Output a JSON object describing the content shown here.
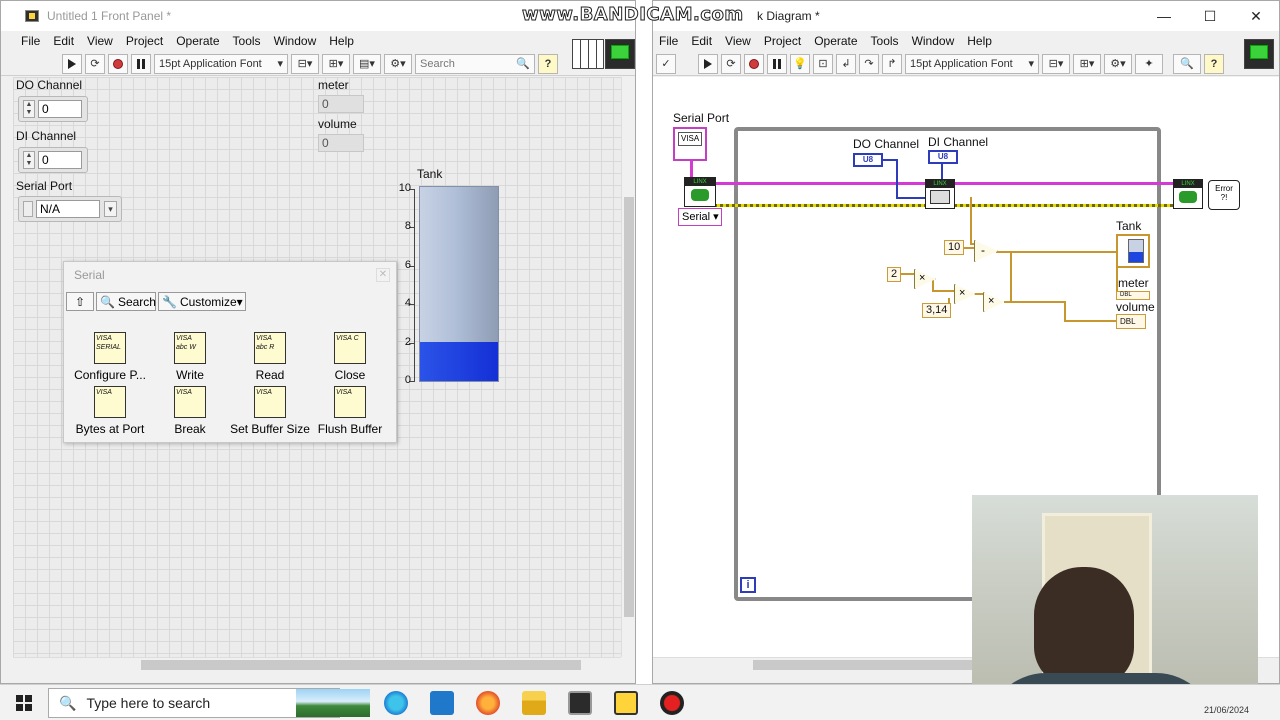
{
  "watermark": "www.BANDICAM.com",
  "front_panel": {
    "title": "Untitled 1 Front Panel *",
    "menu": [
      "File",
      "Edit",
      "View",
      "Project",
      "Operate",
      "Tools",
      "Window",
      "Help"
    ],
    "font_select": "15pt Application Font",
    "search_placeholder": "Search",
    "controls": {
      "do_channel": {
        "label": "DO Channel",
        "value": "0"
      },
      "di_channel": {
        "label": "DI Channel",
        "value": "0"
      },
      "serial_port": {
        "label": "Serial Port",
        "value": "N/A"
      },
      "meter": {
        "label": "meter",
        "value": "0"
      },
      "volume": {
        "label": "volume",
        "value": "0"
      }
    },
    "tank": {
      "label": "Tank",
      "scale": [
        "10",
        "8",
        "6",
        "4",
        "2",
        "0"
      ],
      "scale_max": 10,
      "level": 2
    },
    "palette": {
      "title": "Serial",
      "search": "Search",
      "customize": "Customize▾",
      "items": [
        {
          "label": "Configure P...",
          "icon": "visa-serial-configure-icon",
          "text": "VISA SERIAL"
        },
        {
          "label": "Write",
          "icon": "visa-write-icon",
          "text": "VISA abc W"
        },
        {
          "label": "Read",
          "icon": "visa-read-icon",
          "text": "VISA abc R"
        },
        {
          "label": "Close",
          "icon": "visa-close-icon",
          "text": "VISA C"
        },
        {
          "label": "Bytes at Port",
          "icon": "visa-bytes-at-port-icon",
          "text": "VISA"
        },
        {
          "label": "Break",
          "icon": "visa-break-icon",
          "text": "VISA"
        },
        {
          "label": "Set Buffer Size",
          "icon": "visa-set-buffer-icon",
          "text": "VISA"
        },
        {
          "label": "Flush Buffer",
          "icon": "visa-flush-buffer-icon",
          "text": "VISA"
        }
      ]
    }
  },
  "block_diagram": {
    "title": "k Diagram *",
    "menu": [
      "File",
      "Edit",
      "View",
      "Project",
      "Operate",
      "Tools",
      "Window",
      "Help"
    ],
    "font_select": "15pt Application Font",
    "labels": {
      "serial_port": "Serial Port",
      "serial_enum": "Serial",
      "do_channel": "DO Channel",
      "di_channel": "DI Channel",
      "tank": "Tank",
      "meter": "meter",
      "volume": "volume",
      "visa": "VISA",
      "u8": "U8",
      "linx": "LINX",
      "error": "Error",
      "dbl": "DBL",
      "loop_info": "i"
    },
    "constants": {
      "ten": "10",
      "two": "2",
      "pi": "3,14"
    },
    "ops": {
      "subtract": "-",
      "multiply": "×"
    }
  },
  "taskbar": {
    "search_placeholder": "Type here to search",
    "date": "21/06/2024"
  },
  "colors": {
    "tank_fill": "#1430d6",
    "visa_wire": "#d63ad6",
    "error_wire": "#c8b400",
    "numeric_wire": "#c8962e"
  }
}
